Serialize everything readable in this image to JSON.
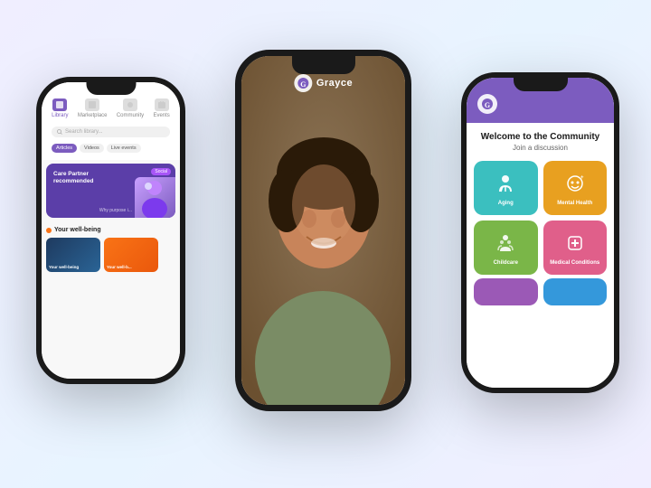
{
  "phones": {
    "left": {
      "nav": [
        {
          "label": "Library",
          "active": true
        },
        {
          "label": "Marketplace",
          "active": false
        },
        {
          "label": "Community",
          "active": false
        },
        {
          "label": "Events",
          "active": false
        }
      ],
      "search_placeholder": "Search library...",
      "tags": [
        "Articles",
        "Videos",
        "Live events"
      ],
      "card_title": "Care Partner recommended",
      "card_badge": "Social",
      "card_right_text": "Why purpose i...",
      "wellbeing_label": "Your well-being",
      "thumbnails": [
        {
          "label": "Your well-being",
          "color": "dark-blue"
        },
        {
          "label": "Your well-b...",
          "color": "orange"
        }
      ]
    },
    "center": {
      "logo_letter": "G",
      "brand_name": "Grayce"
    },
    "right": {
      "logo_letter": "G",
      "welcome_title": "Welcome to the Community",
      "welcome_sub": "Join a discussion",
      "grid_items": [
        {
          "label": "Aging",
          "color": "teal",
          "icon": "♿"
        },
        {
          "label": "Mental Health",
          "color": "gold",
          "icon": "😊"
        },
        {
          "label": "Childcare",
          "color": "green",
          "icon": "👨‍👧"
        },
        {
          "label": "Medical Conditions",
          "color": "pink",
          "icon": "⚕"
        }
      ],
      "bottom_items": [
        {
          "color": "purple"
        },
        {
          "color": "blue"
        }
      ]
    }
  }
}
